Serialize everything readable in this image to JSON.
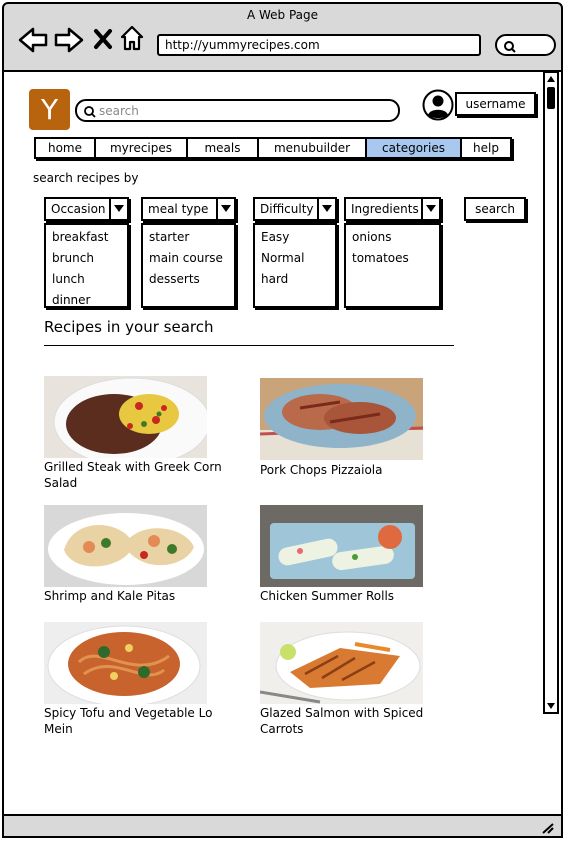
{
  "window": {
    "title": "A Web Page",
    "url": "http://yummyrecipes.com"
  },
  "header": {
    "logo_letter": "Y",
    "search_placeholder": "search",
    "username": "username"
  },
  "nav": {
    "tabs": [
      "home",
      "myrecipes",
      "meals",
      "menubuilder",
      "categories",
      "help"
    ],
    "active": "categories"
  },
  "filters": {
    "label": "search recipes by",
    "groups": [
      {
        "label": "Occasion",
        "options": [
          "breakfast",
          "brunch",
          "lunch",
          "dinner"
        ]
      },
      {
        "label": "meal type",
        "options": [
          "starter",
          "main course",
          "desserts"
        ]
      },
      {
        "label": "Difficulty",
        "options": [
          "Easy",
          "Normal",
          "hard"
        ]
      },
      {
        "label": "Ingredients",
        "options": [
          "onions",
          "tomatoes"
        ]
      }
    ],
    "search_button": "search"
  },
  "results": {
    "title": "Recipes in your search",
    "recipes": [
      {
        "title": "Grilled Steak with Greek Corn Salad",
        "image": "steak-corn-salad-photo"
      },
      {
        "title": "Pork Chops Pizzaiola",
        "image": "pork-chops-photo"
      },
      {
        "title": "Shrimp and Kale Pitas",
        "image": "shrimp-pitas-photo"
      },
      {
        "title": "Chicken Summer Rolls",
        "image": "summer-rolls-photo"
      },
      {
        "title": "Spicy Tofu and Vegetable Lo Mein",
        "image": "lo-mein-photo"
      },
      {
        "title": "Glazed Salmon with Spiced Carrots",
        "image": "glazed-salmon-photo"
      }
    ]
  },
  "colors": {
    "chrome": "#d9d9d9",
    "logo": "#b8640f",
    "active_tab": "#a8c8f0"
  }
}
